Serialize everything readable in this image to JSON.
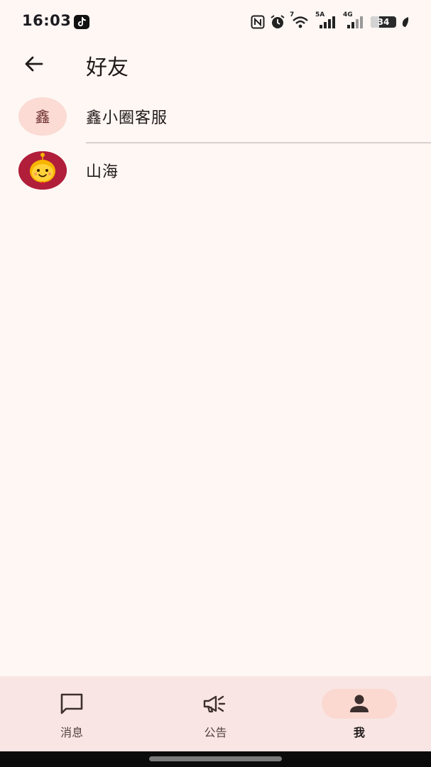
{
  "status_bar": {
    "time": "16:03",
    "network_label": "7",
    "network_5g": "5A",
    "network_4g": "4G",
    "battery_level": "34",
    "icons": [
      "tiktok-icon",
      "nfc-icon",
      "alarm-icon",
      "wifi-icon",
      "signal-5a-icon",
      "signal-4g-icon",
      "battery-icon",
      "leaf-icon"
    ]
  },
  "header": {
    "title": "好友",
    "back_icon": "arrow-left-icon"
  },
  "friends": [
    {
      "name": "鑫小圈客服",
      "avatar_text": "鑫",
      "avatar_type": "text"
    },
    {
      "name": "山海",
      "avatar_type": "image",
      "avatar_icon": "smiley-mascot-icon"
    }
  ],
  "bottom_nav": {
    "items": [
      {
        "label": "消息",
        "icon": "message-icon",
        "active": false
      },
      {
        "label": "公告",
        "icon": "megaphone-icon",
        "active": false
      },
      {
        "label": "我",
        "icon": "person-icon",
        "active": true
      }
    ]
  },
  "colors": {
    "background": "#fef7f4",
    "nav_background": "#f9e6e4",
    "active_pill": "#fbd9d1",
    "avatar_bg": "#fbdbd4",
    "avatar_red": "#b11e3a",
    "text_primary": "#201a19"
  }
}
